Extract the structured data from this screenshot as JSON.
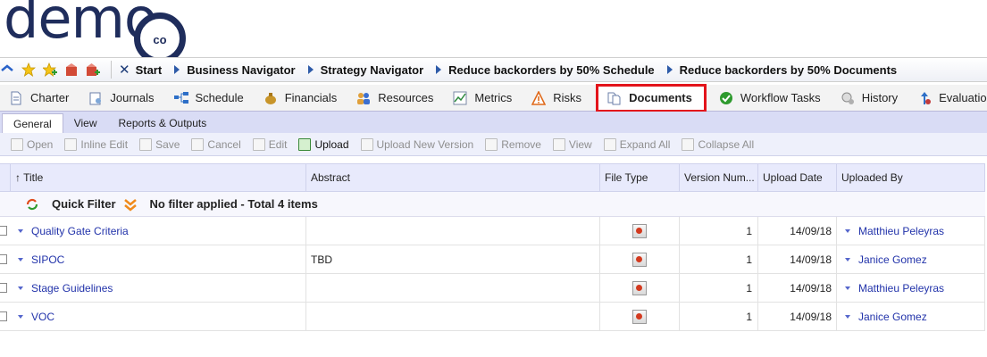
{
  "logo": {
    "word": "demo",
    "badge": "co"
  },
  "breadcrumb": {
    "quick_icons": [
      "navigate-icon",
      "star-icon",
      "add-favorite-icon",
      "box-icon",
      "box-add-icon"
    ],
    "items": [
      {
        "label": "Start",
        "icon": "x-icon"
      },
      {
        "label": "Business Navigator"
      },
      {
        "label": "Strategy Navigator"
      },
      {
        "label": "Reduce backorders by 50% Schedule"
      },
      {
        "label": "Reduce backorders by 50% Documents"
      }
    ]
  },
  "tabs": [
    {
      "label": "Charter",
      "icon": "document-icon"
    },
    {
      "label": "Journals",
      "icon": "journal-icon"
    },
    {
      "label": "Schedule",
      "icon": "schedule-icon"
    },
    {
      "label": "Financials",
      "icon": "money-bag-icon"
    },
    {
      "label": "Resources",
      "icon": "people-icon"
    },
    {
      "label": "Metrics",
      "icon": "chart-icon"
    },
    {
      "label": "Risks",
      "icon": "warning-icon"
    },
    {
      "label": "Documents",
      "icon": "documents-icon",
      "active": true
    },
    {
      "label": "Workflow Tasks",
      "icon": "check-circle-icon"
    },
    {
      "label": "History",
      "icon": "history-icon"
    },
    {
      "label": "Evaluation Criteria",
      "icon": "evaluation-icon"
    }
  ],
  "subtabs": [
    {
      "label": "General",
      "active": true
    },
    {
      "label": "View"
    },
    {
      "label": "Reports & Outputs"
    }
  ],
  "toolbar": [
    {
      "label": "Open",
      "enabled": false
    },
    {
      "label": "Inline Edit",
      "enabled": false
    },
    {
      "label": "Save",
      "enabled": false
    },
    {
      "label": "Cancel",
      "enabled": false
    },
    {
      "label": "Edit",
      "enabled": false
    },
    {
      "label": "Upload",
      "enabled": true
    },
    {
      "label": "Upload New Version",
      "enabled": false
    },
    {
      "label": "Remove",
      "enabled": false
    },
    {
      "label": "View",
      "enabled": false
    },
    {
      "label": "Expand All",
      "enabled": false
    },
    {
      "label": "Collapse All",
      "enabled": false
    }
  ],
  "grid": {
    "columns": [
      "↑ Title",
      "Abstract",
      "File Type",
      "Version Num...",
      "Upload Date",
      "Uploaded By"
    ],
    "quick_filter_label": "Quick Filter",
    "filter_status": "No filter applied - Total 4 items",
    "rows": [
      {
        "title": "Quality Gate Criteria",
        "abstract": "",
        "version": "1",
        "date": "14/09/18",
        "by": "Matthieu Peleyras"
      },
      {
        "title": "SIPOC",
        "abstract": "TBD",
        "version": "1",
        "date": "14/09/18",
        "by": "Janice Gomez"
      },
      {
        "title": "Stage Guidelines",
        "abstract": "",
        "version": "1",
        "date": "14/09/18",
        "by": "Matthieu Peleyras"
      },
      {
        "title": "VOC",
        "abstract": "",
        "version": "1",
        "date": "14/09/18",
        "by": "Janice Gomez"
      }
    ]
  },
  "colors": {
    "brand_navy": "#1f2d5c",
    "highlight_red": "#e3141b",
    "link_blue": "#2233aa",
    "subtab_bg": "#d9dcf5"
  }
}
